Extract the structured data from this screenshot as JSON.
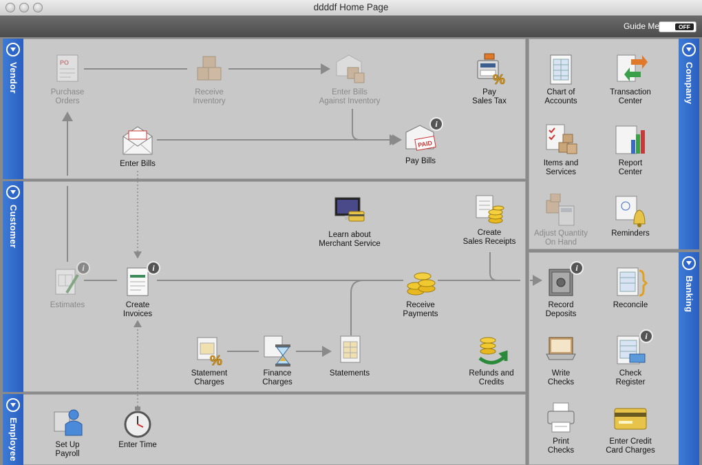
{
  "window": {
    "title": "ddddf Home Page"
  },
  "toolbar": {
    "guide_label": "Guide Me",
    "toggle_state": "OFF"
  },
  "tabs": {
    "vendor": "Vendor",
    "customer": "Customer",
    "employee": "Employee",
    "company": "Company",
    "banking": "Banking"
  },
  "vendor": {
    "purchase_orders": "Purchase\nOrders",
    "receive_inventory": "Receive\nInventory",
    "enter_bills_inventory": "Enter Bills\nAgainst Inventory",
    "pay_sales_tax": "Pay\nSales Tax",
    "enter_bills": "Enter Bills",
    "pay_bills": "Pay Bills"
  },
  "customer": {
    "learn_merchant": "Learn about\nMerchant Service",
    "create_sales_receipts": "Create\nSales Receipts",
    "estimates": "Estimates",
    "create_invoices": "Create\nInvoices",
    "receive_payments": "Receive\nPayments",
    "statement_charges": "Statement\nCharges",
    "finance_charges": "Finance\nCharges",
    "statements": "Statements",
    "refunds_credits": "Refunds and\nCredits"
  },
  "employee": {
    "setup_payroll": "Set Up\nPayroll",
    "enter_time": "Enter Time"
  },
  "company": {
    "chart_accounts": "Chart of\nAccounts",
    "transaction_center": "Transaction\nCenter",
    "items_services": "Items and\nServices",
    "report_center": "Report\nCenter",
    "adjust_quantity": "Adjust Quantity\nOn Hand",
    "reminders": "Reminders"
  },
  "banking": {
    "record_deposits": "Record\nDeposits",
    "reconcile": "Reconcile",
    "write_checks": "Write\nChecks",
    "check_register": "Check\nRegister",
    "print_checks": "Print\nChecks",
    "enter_cc_charges": "Enter Credit\nCard Charges"
  },
  "icons": {
    "info": "i",
    "po_tag": "PO",
    "paid_stamp": "PAID",
    "percent": "%"
  }
}
